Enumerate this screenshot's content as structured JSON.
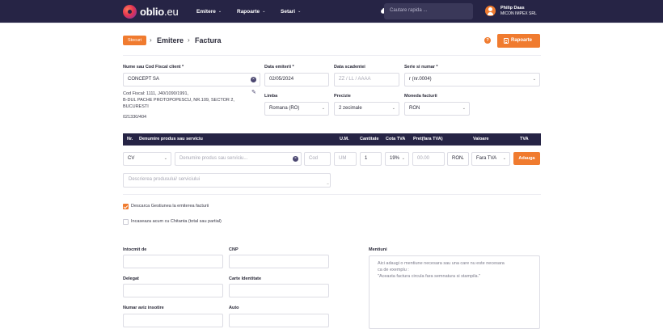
{
  "nav": {
    "logo_main": "oblio",
    "logo_tld": ".eu",
    "menu": [
      {
        "label": "Emitere"
      },
      {
        "label": "Rapoarte"
      },
      {
        "label": "Setari"
      }
    ],
    "search_placeholder": "Cautare rapida ...",
    "user_name": "Philip Daas",
    "user_company": "MICON IMPEX SRL"
  },
  "header": {
    "badge": "Stocuri",
    "crumb_1": "Emitere",
    "crumb_2": "Factura",
    "help": "?",
    "report_button": "Rapoarte"
  },
  "client": {
    "label": "Nume sau Cod Fiscal client *",
    "value": "CONCEPT SA",
    "info": [
      "Cod Fiscal: 1111, J40/1090/1991,",
      "B-DUL PACHE PROTOPOPESCU, NR.109, SECTOR 2,",
      "BUCURESTI",
      "021330/404"
    ]
  },
  "fields": {
    "data_emiterii_label": "Data emiterii *",
    "data_emiterii": "02/05/2024",
    "data_scadentei_label": "Data scadentei",
    "data_scadentei_ph": "ZZ / LL / AAAA",
    "serie_label": "Serie si numar *",
    "serie": "r (nr.0004)",
    "limba_label": "Limba",
    "limba": "Romana (RO)",
    "precizie_label": "Precizie",
    "precizie": "2 zecimale",
    "moneda_label": "Moneda facturii",
    "moneda": "RON"
  },
  "table": {
    "headers": {
      "nr": "Nr.",
      "denumire": "Denumire produs sau serviciu",
      "um": "U.M.",
      "cantitate": "Cantitate",
      "cota": "Cota TVA",
      "pret": "Pret(fara TVA)",
      "valoare": "Valoare",
      "tva": "TVA"
    },
    "row": {
      "tip": "CV",
      "denumire_ph": "Denumire produs sau serviciu...",
      "cod_ph": "Cod",
      "um_ph": "UM",
      "cantitate": "1",
      "cota": "19%",
      "pret_ph": "00.00",
      "moneda": "RON",
      "tva_opt": "Fara TVA",
      "add_button": "Adauga"
    },
    "descriere_ph": "Descrierea produsului/ serviciului"
  },
  "checks": {
    "descarca": "Descarca Gestiunea la emiterea facturii",
    "incaseaza": "Incaseaza acum cu Chitanta (total sau partial)"
  },
  "bottom": {
    "intocmit_label": "Intocmit de",
    "cnp_label": "CNP",
    "delegat_label": "Delegat",
    "carte_label": "Carte Identitate",
    "aviz_label": "Numar aviz insotire",
    "auto_label": "Auto",
    "mentiuni_label": "Mentiuni",
    "mentiuni_lines": [
      "Aici adaugi o mentiune necesara sau una care nu este necesara",
      "ca de exemplu :",
      "\"Aceasta factura circula fara semnatura si stampila.\""
    ]
  }
}
